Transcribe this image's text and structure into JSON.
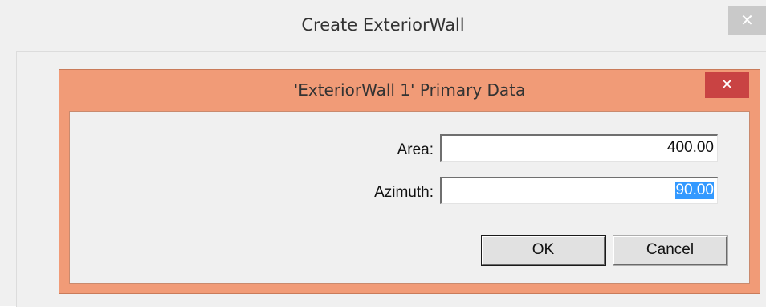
{
  "outer_window": {
    "title": "Create ExteriorWall",
    "close_glyph": "✕"
  },
  "dialog": {
    "title": "'ExteriorWall 1' Primary Data",
    "close_glyph": "✕",
    "fields": [
      {
        "label": "Area:",
        "value": "400.00"
      },
      {
        "label": "Azimuth:",
        "value": "90.00",
        "selected": true
      }
    ],
    "buttons": {
      "ok_label": "OK",
      "cancel_label": "Cancel"
    }
  },
  "colors": {
    "dialog_frame": "#f19b77",
    "close_button_active": "#c94343",
    "close_button_inactive": "#c9c9c9",
    "selection_highlight": "#3399ff"
  },
  "icons": {
    "outer_close": "close-icon",
    "dialog_close": "close-icon"
  }
}
